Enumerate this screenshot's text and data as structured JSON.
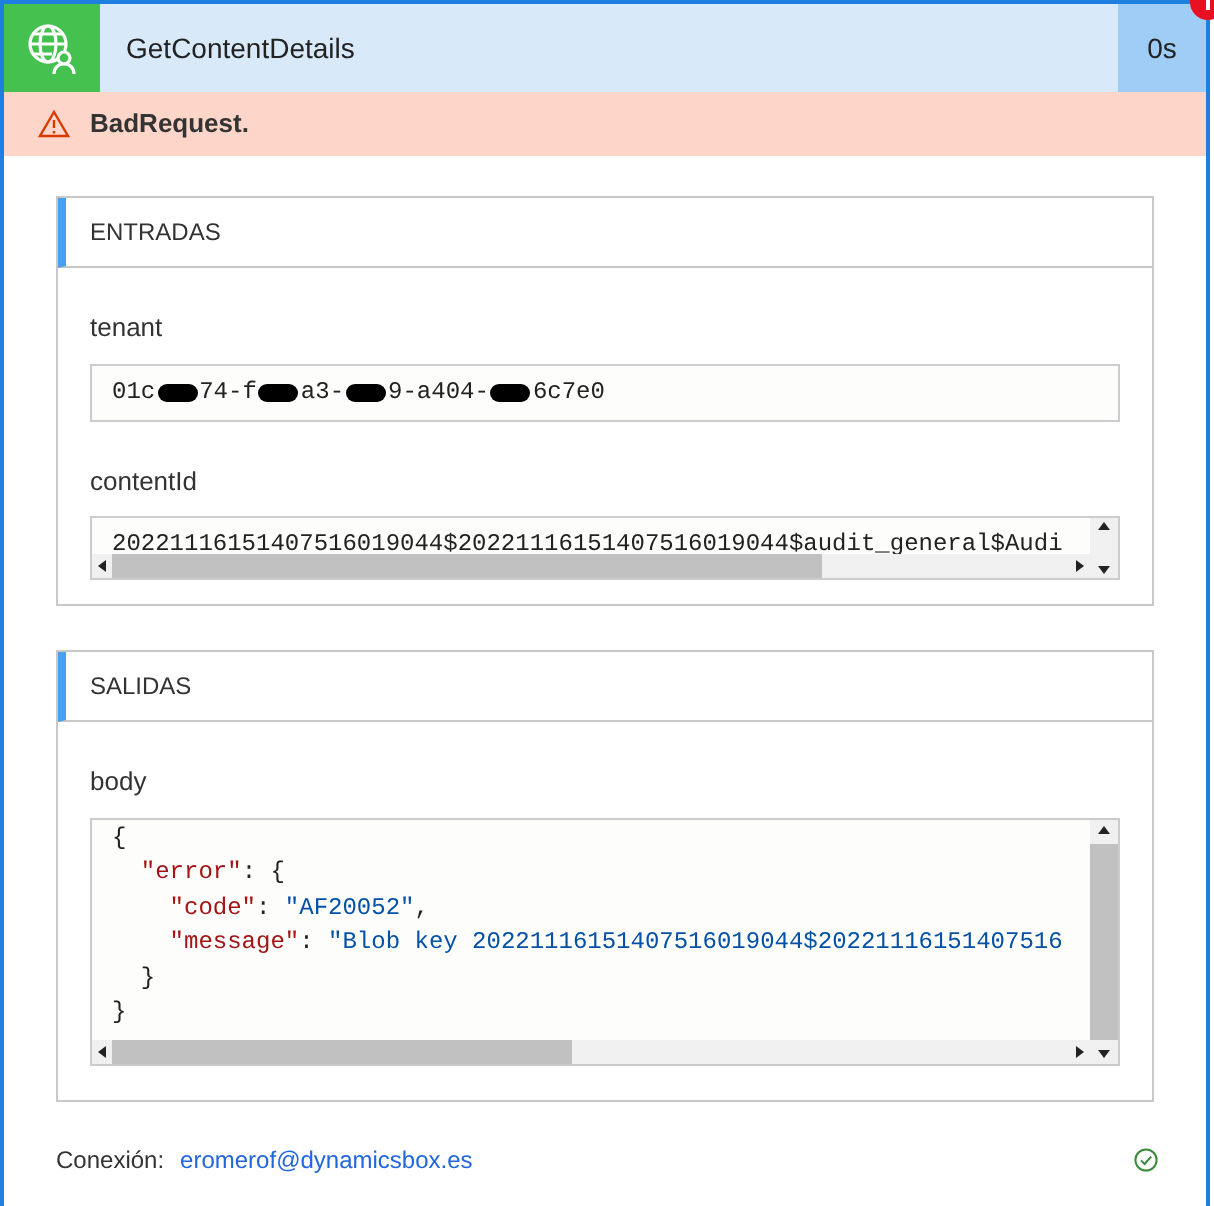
{
  "header": {
    "title": "GetContentDetails",
    "duration": "0s",
    "has_error": true
  },
  "error_bar": {
    "message": "BadRequest."
  },
  "sections": [
    {
      "title": "ENTRADAS",
      "fields": [
        {
          "label": "tenant",
          "kind": "redacted",
          "segments": [
            "01c",
            "74-f",
            "a3-",
            "9-a404-",
            "6c7e0"
          ]
        },
        {
          "label": "contentId",
          "kind": "scroll",
          "value": "20221116151407516019044$20221116151407516019044$audit_general$Audi"
        }
      ]
    },
    {
      "title": "SALIDAS",
      "fields": [
        {
          "label": "body",
          "kind": "code",
          "lines": [
            [
              {
                "kind": "punct",
                "text": "{"
              }
            ],
            [
              {
                "kind": "key",
                "text": "  \"error\""
              },
              {
                "kind": "punct",
                "text": ": {"
              }
            ],
            [
              {
                "kind": "key",
                "text": "    \"code\""
              },
              {
                "kind": "punct",
                "text": ": "
              },
              {
                "kind": "string",
                "text": "\"AF20052\""
              },
              {
                "kind": "punct",
                "text": ","
              }
            ],
            [
              {
                "kind": "key",
                "text": "    \"message\""
              },
              {
                "kind": "punct",
                "text": ": "
              },
              {
                "kind": "string",
                "text": "\"Blob key 20221116151407516019044$20221116151407516"
              }
            ],
            [
              {
                "kind": "punct",
                "text": "  }"
              }
            ],
            [
              {
                "kind": "punct",
                "text": "}"
              }
            ]
          ]
        }
      ]
    }
  ],
  "footer": {
    "label": "Conexión:",
    "account": "eromerof@dynamicsbox.es",
    "connected": true
  }
}
